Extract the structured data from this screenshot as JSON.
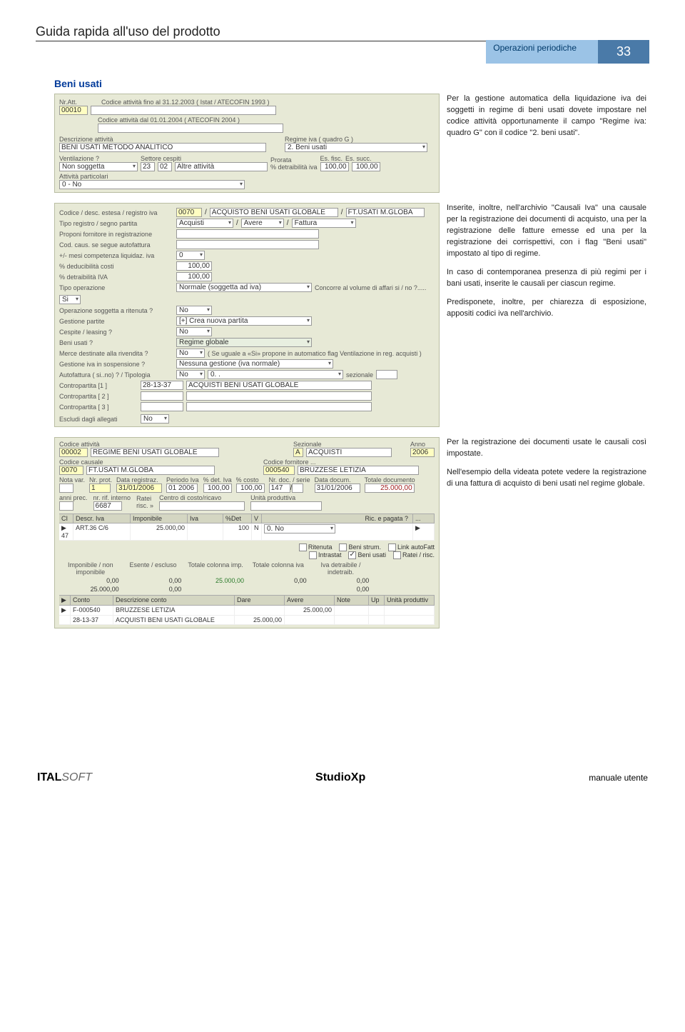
{
  "header": {
    "doc_title": "Guida rapida all'uso del prodotto",
    "subtitle": "Operazioni periodiche",
    "page_number": "33"
  },
  "section": {
    "title": "Beni usati"
  },
  "panel1": {
    "nr_att_label": "Nr.Att.",
    "nr_att_value": "00010",
    "cod_att_1993_label": "Codice attività fino al 31.12.2003 ( Istat / ATECOFIN 1993 )",
    "cod_att_1993_value": "",
    "cod_att_2004_label": "Codice attività dal 01.01.2004 ( ATECOFIN 2004 )",
    "cod_att_2004_value": "",
    "descr_label": "Descrizione attività",
    "descr_value": "BENI USATI METODO ANALITICO",
    "regime_label": "Regime iva ( quadro G )",
    "regime_value": "2. Beni usati",
    "vent_label": "Ventilazione ?",
    "vent_value": "Non soggetta",
    "settore_label": "Settore cespiti",
    "settore_code": "23",
    "settore_sub": "02",
    "settore_desc": "Altre attività",
    "prorata_label": "Prorata",
    "esfisc_label": "Es. fisc.",
    "essucc_label": "Es. succ.",
    "detr_label": "% detraibilità iva",
    "detr_v1": "100,00",
    "detr_v2": "100,00",
    "attpart_label": "Attività particolari",
    "attpart_value": "0 - No"
  },
  "side1": {
    "p1": "Per la gestione automatica della liquidazione iva dei soggetti in regime di beni usati dovete impostare nel codice attività opportunamente il campo \"Regime iva: quadro G\" con il codice \"2. beni usati\"."
  },
  "panel2": {
    "cod_desc_label": "Codice / desc. estesa / registro iva",
    "cod": "0070",
    "desc": "ACQUISTO BENI USATI GLOBALE",
    "reg": "FT.USATI M.GLOBA",
    "tipo_reg_label": "Tipo registro / segno partita",
    "tipo_reg": "Acquisti",
    "segno": "Avere",
    "partita": "Fattura",
    "proponi_label": "Proponi fornitore in registrazione",
    "cod_caus_label": "Cod. caus. se segue autofattura",
    "mesi_label": "+/- mesi competenza liquidaz. iva",
    "mesi_value": "0",
    "deduc_label": "% deducibilità costi",
    "deduc_value": "100,00",
    "detiva_label": "% detraibilità IVA",
    "detiva_value": "100,00",
    "tipo_op_label": "Tipo operazione",
    "tipo_op_value": "Normale (soggetta ad iva)",
    "concorre_label": "Concorre al volume di affari si / no ?.....",
    "concorre_value": "Si",
    "riten_label": "Operazione soggetta a ritenuta ?",
    "riten_value": "No",
    "gest_part_label": "Gestione partite",
    "gest_part_value": "[+] Crea nuova partita",
    "cespite_label": "Cespite / leasing ?",
    "cespite_value": "No",
    "beni_usati_label": "Beni usati ?",
    "beni_usati_value": "Regime globale",
    "merce_label": "Merce destinate alla rivendita ?",
    "merce_value": "No",
    "merce_note": "( Se uguale a «Si» propone in automatico flag Ventilazione in reg. acquisti )",
    "sosp_label": "Gestione iva in sospensione ?",
    "sosp_value": "Nessuna gestione (iva normale)",
    "autofatt_label": "Autofattura ( si..no) ? / Tipologia",
    "autofatt_value": "No",
    "autofatt_tip": "0. .",
    "sezionale": "sezionale",
    "contro1_label": "Contropartita [1 ]",
    "contro1_code": "28-13-37",
    "contro1_desc": "ACQUISTI BENI USATI GLOBALE",
    "contro2_label": "Contropartita [ 2 ]",
    "contro3_label": "Contropartita [ 3 ]",
    "escludi_label": "Escludi dagli allegati",
    "escludi_value": "No"
  },
  "side2": {
    "p1": "Inserite, inoltre, nell'archivio \"Causali Iva\" una causale per la registrazione dei documenti di acquisto, una per la registrazione delle fatture emesse ed una per la registrazione dei corrispettivi, con i flag \"Beni usati\" impostato al tipo di regime.",
    "p2": "In caso di contemporanea presenza di più regimi per i bani usati, inserite le causali per ciascun regime.",
    "p3": "Predisponete, inoltre, per chiarezza di esposizione, appositi codici iva nell'archivio."
  },
  "panel3": {
    "cod_att_label": "Codice attività",
    "cod_att_code": "00002",
    "cod_att_desc": "REGIME BENI USATI GLOBALE",
    "sezionale_label": "Sezionale",
    "sezionale_code": "A",
    "sezionale_desc": "ACQUISTI",
    "anno_label": "Anno",
    "anno_value": "2006",
    "cod_caus_label": "Codice causale",
    "cod_caus_code": "0070",
    "cod_caus_desc": "FT.USATI M.GLOBA",
    "cod_forn_label": "Codice fornitore ...",
    "cod_forn_code": "000540",
    "cod_forn_desc": "BRUZZESE LETIZIA",
    "nota_label": "Nota var.",
    "nrprot_label": "Nr. prot.",
    "nrprot_value": "1",
    "data_reg_label": "Data registraz.",
    "data_reg_value": "31/01/2006",
    "periodo_label": "Periodo Iva",
    "periodo_value": "01 2006",
    "detiva_label": "% det. Iva",
    "detiva_value": "100,00",
    "costo_label": "% costo",
    "costo_value": "100,00",
    "nrdoc_label": "Nr. doc. / serie",
    "nrdoc_value": "147",
    "datadoc_label": "Data docum.",
    "datadoc_value": "31/01/2006",
    "totdoc_label": "Totale documento",
    "totdoc_value": "25.000,00",
    "anni_label": "anni prec.",
    "nrrif_label": "nr. rif. interno",
    "nrrif_value": "6687",
    "ratei_label": "Ratei",
    "risc_label": "risc. »",
    "centro_label": "Centro di costo/ricavo",
    "unita_label": "Unità produttiva",
    "row_cl": "47",
    "row_descr": "ART.36 C/6",
    "row_imp": "25.000,00",
    "row_iva": "",
    "row_pdet": "100",
    "row_v": "N",
    "ric_label": "Ric. e pagata ?",
    "ric_value": "0. No",
    "chk_ritenuta": "Ritenuta",
    "chk_benistrum": "Beni strum.",
    "chk_linkauto": "Link autoFatt",
    "chk_intrastat": "Intrastat",
    "chk_beniusati": "Beni usati",
    "chk_ratei": "Ratei / risc.",
    "totals": {
      "h1": "Imponibile / non imponibile",
      "h2": "Esente / escluso",
      "h3": "Totale colonna imp.",
      "h4": "Totale colonna iva",
      "h5": "Iva detraibile / indetraib.",
      "r1": [
        "0,00",
        "0,00",
        "25.000,00",
        "0,00",
        "0,00"
      ],
      "r2": [
        "25.000,00",
        "0,00",
        "",
        "",
        "0,00"
      ]
    },
    "footer_rows": [
      {
        "conto": "F-000540",
        "desc": "BRUZZESE LETIZIA",
        "dare": "",
        "avere": "25.000,00",
        "note": ""
      },
      {
        "conto": "28-13-37",
        "desc": "ACQUISTI BENI USATI GLOBALE",
        "dare": "25.000,00",
        "avere": "",
        "note": ""
      }
    ],
    "ft_conto": "Conto",
    "ft_desc": "Descrizione conto",
    "ft_dare": "Dare",
    "ft_avere": "Avere",
    "ft_note": "Note",
    "ft_up": "Up",
    "ft_unita": "Unità produttiv"
  },
  "side3": {
    "p1": "Per la registrazione dei documenti usate le causali così impostate.",
    "p2": "Nell'esempio della videata potete vedere la registrazione di una fattura di acquisto di beni usati nel regime globale."
  },
  "footer": {
    "brand_bold": "ITAL",
    "brand_italic": "SOFT",
    "center": "StudioXp",
    "right": "manuale utente"
  }
}
